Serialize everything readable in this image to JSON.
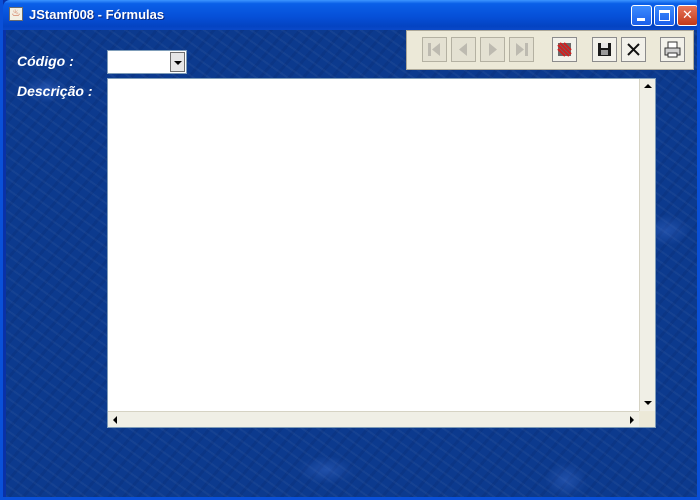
{
  "window": {
    "title": "JStamf008 - Fórmulas",
    "app_icon": "java-cup-icon",
    "controls": [
      "minimize-icon",
      "maximize-icon",
      "close-icon"
    ],
    "titlebar_color": "#0650d8"
  },
  "form": {
    "codigo_label": "Código :",
    "codigo_value": "",
    "descricao_label": "Descrição :",
    "descricao_value": ""
  },
  "toolbar": {
    "buttons": [
      {
        "icon": "first-record-icon",
        "enabled": false
      },
      {
        "icon": "previous-record-icon",
        "enabled": false
      },
      {
        "icon": "next-record-icon",
        "enabled": false
      },
      {
        "icon": "last-record-icon",
        "enabled": false
      },
      {
        "icon": "delete-record-icon",
        "enabled": true
      },
      {
        "icon": "save-icon",
        "enabled": true
      },
      {
        "icon": "cancel-icon",
        "enabled": true
      },
      {
        "icon": "print-icon",
        "enabled": true
      }
    ]
  },
  "colors": {
    "background": "#0c3a8e",
    "label_text": "#ffffff",
    "toolbar_bg": "#ece9d8"
  }
}
